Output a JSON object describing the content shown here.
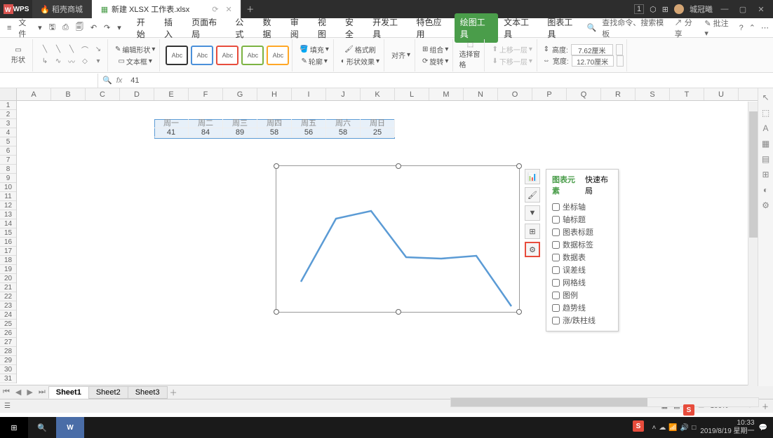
{
  "titlebar": {
    "wps": "WPS",
    "store_tab": "稻壳商城",
    "active_tab": "新建 XLSX 工作表.xlsx",
    "user": "城冠曦",
    "badge": "1"
  },
  "menubar": {
    "file": "文件",
    "tabs": [
      "开始",
      "插入",
      "页面布局",
      "公式",
      "数据",
      "审阅",
      "视图",
      "安全",
      "开发工具",
      "特色应用",
      "绘图工具",
      "文本工具",
      "图表工具"
    ],
    "active_tab_idx": 10,
    "search1": "查找命令、搜索模板",
    "share": "分享",
    "annotate": "批注"
  },
  "ribbon": {
    "shape_label": "形状",
    "edit_shape": "编辑形状",
    "textbox": "文本框",
    "abc": "Abc",
    "fill": "填充",
    "outline": "轮廓",
    "format": "格式刷",
    "shape_effect": "形状效果",
    "align": "对齐",
    "group": "组合",
    "rotate": "旋转",
    "bring_fwd": "上移一层",
    "send_back": "下移一层",
    "sel_pane": "选择窗格",
    "height_label": "高度:",
    "height_val": "7.62厘米",
    "width_label": "宽度:",
    "width_val": "12.70厘米"
  },
  "fxbar": {
    "content": "41"
  },
  "columns": [
    "A",
    "B",
    "C",
    "D",
    "E",
    "F",
    "G",
    "H",
    "I",
    "J",
    "K",
    "L",
    "M",
    "N",
    "O",
    "P",
    "Q",
    "R",
    "S",
    "T",
    "U"
  ],
  "table": {
    "headers": [
      "周一",
      "周二",
      "周三",
      "周四",
      "周五",
      "周六",
      "周日"
    ],
    "values": [
      "41",
      "84",
      "89",
      "58",
      "56",
      "58",
      "25"
    ]
  },
  "popup": {
    "tab1": "图表元素",
    "tab2": "快速布局",
    "items": [
      "坐标轴",
      "轴标题",
      "图表标题",
      "数据标签",
      "数据表",
      "误差线",
      "网格线",
      "图例",
      "趋势线",
      "涨/跌柱线"
    ]
  },
  "sheets": {
    "s1": "Sheet1",
    "s2": "Sheet2",
    "s3": "Sheet3"
  },
  "statusbar": {
    "zoom": "100%"
  },
  "taskbar": {
    "time": "10:33",
    "date": "2019/8/19 星期一"
  },
  "chart_data": {
    "type": "line",
    "categories": [
      "周一",
      "周二",
      "周三",
      "周四",
      "周五",
      "周六",
      "周日"
    ],
    "values": [
      41,
      84,
      89,
      58,
      56,
      58,
      25
    ],
    "title": "",
    "xlabel": "",
    "ylabel": "",
    "ylim": [
      0,
      100
    ],
    "legend": false,
    "grid": false
  }
}
